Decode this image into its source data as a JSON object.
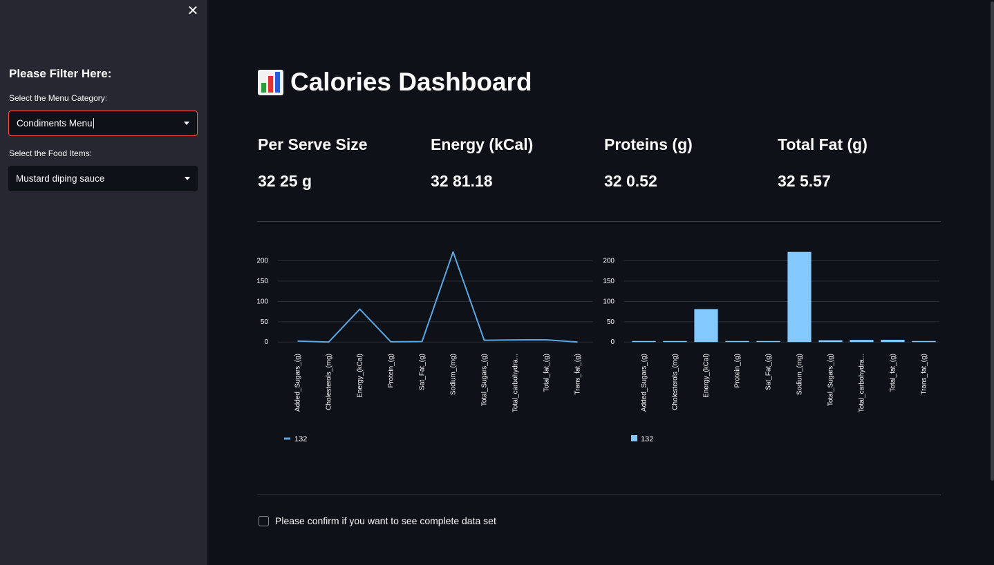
{
  "sidebar": {
    "close_icon": "✕",
    "title": "Please Filter Here:",
    "category_label": "Select the Menu Category:",
    "category_value": "Condiments Menu",
    "items_label": "Select the Food Items:",
    "items_value": "Mustard diping sauce"
  },
  "main": {
    "title": "Calories Dashboard",
    "title_icon": "bar-chart-emoji-icon",
    "metrics": [
      {
        "label": "Per Serve Size",
        "value": "32 25 g"
      },
      {
        "label": "Energy (kCal)",
        "value": "32 81.18"
      },
      {
        "label": "Proteins (g)",
        "value": "32 0.52"
      },
      {
        "label": "Total Fat (g)",
        "value": "32 5.57"
      }
    ],
    "checkbox_label": "Please confirm if you want to see complete data set"
  },
  "colors": {
    "line": "#5aa9e6",
    "bar": "#83c9ff",
    "accent": "#ff4b4b"
  },
  "chart_data": [
    {
      "type": "line",
      "categories": [
        "Added_Sugars_(g)",
        "Cholesterols_(mg)",
        "Energy_(kCal)",
        "Protein_(g)",
        "Sat_Fat_(g)",
        "Sodium_(mg)",
        "Total_Sugars_(g)",
        "Total_carbohydra...",
        "Total_fat_(g)",
        "Trans_fat_(g)"
      ],
      "series": [
        {
          "name": "132",
          "values": [
            2.5,
            0,
            81.18,
            0.52,
            1.2,
            222,
            4.5,
            5.3,
            5.57,
            0
          ]
        }
      ],
      "yticks": [
        0,
        50,
        100,
        150,
        200
      ],
      "ylim": [
        -3,
        230
      ],
      "grid": true,
      "legend": "bottom-left"
    },
    {
      "type": "bar",
      "categories": [
        "Added_Sugars_(g)",
        "Cholesterols_(mg)",
        "Energy_(kCal)",
        "Protein_(g)",
        "Sat_Fat_(g)",
        "Sodium_(mg)",
        "Total_Sugars_(g)",
        "Total_carbohydra...",
        "Total_fat_(g)",
        "Trans_fat_(g)"
      ],
      "series": [
        {
          "name": "132",
          "values": [
            2.5,
            0,
            81.18,
            0.52,
            1.2,
            222,
            4.5,
            5.3,
            5.57,
            0
          ]
        }
      ],
      "yticks": [
        0,
        50,
        100,
        150,
        200
      ],
      "ylim": [
        -3,
        230
      ],
      "grid": true,
      "legend": "bottom-left"
    }
  ]
}
